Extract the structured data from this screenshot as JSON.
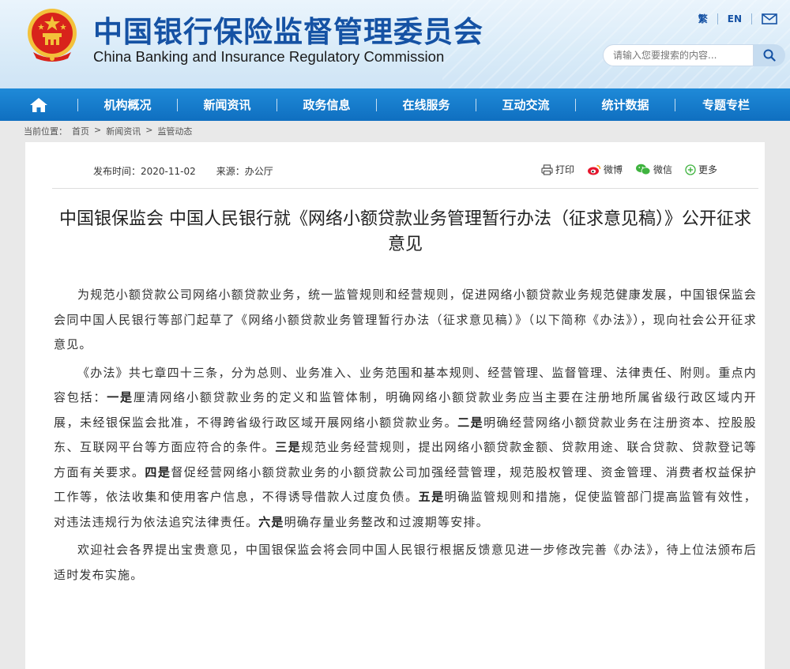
{
  "header": {
    "title_cn": "中国银行保险监督管理委员会",
    "title_en": "China Banking and Insurance Regulatory Commission",
    "lang_traditional": "繁",
    "lang_en": "EN",
    "search_placeholder": "请输入您要搜索的内容...",
    "icons": {
      "emblem": "national-emblem",
      "mail": "mail-icon",
      "search": "search-icon"
    }
  },
  "nav": {
    "home_icon": "home-icon",
    "items": [
      "机构概况",
      "新闻资讯",
      "政务信息",
      "在线服务",
      "互动交流",
      "统计数据",
      "专题专栏"
    ]
  },
  "breadcrumb": {
    "prefix": "当前位置：",
    "items": [
      "首页",
      "新闻资讯",
      "监管动态"
    ],
    "separator": ">"
  },
  "article": {
    "publish_time": "发布时间：2020-11-02",
    "source": "来源：办公厅",
    "share": {
      "print": "打印",
      "weibo": "微博",
      "wechat": "微信",
      "more": "更多"
    },
    "title": "中国银保监会 中国人民银行就《网络小额贷款业务管理暂行办法（征求意见稿）》公开征求意见",
    "p1": "为规范小额贷款公司网络小额贷款业务，统一监管规则和经营规则，促进网络小额贷款业务规范健康发展，中国银保监会会同中国人民银行等部门起草了《网络小额贷款业务管理暂行办法（征求意见稿）》（以下简称《办法》），现向社会公开征求意见。",
    "p2_intro": "《办法》共七章四十三条，分为总则、业务准入、业务范围和基本规则、经营管理、监督管理、法律责任、附则。重点内容包括：",
    "p2_k1": "一是",
    "p2_t1": "厘清网络小额贷款业务的定义和监管体制，明确网络小额贷款业务应当主要在注册地所属省级行政区域内开展，未经银保监会批准，不得跨省级行政区域开展网络小额贷款业务。",
    "p2_k2": "二是",
    "p2_t2": "明确经营网络小额贷款业务在注册资本、控股股东、互联网平台等方面应符合的条件。",
    "p2_k3": "三是",
    "p2_t3": "规范业务经营规则，提出网络小额贷款金额、贷款用途、联合贷款、贷款登记等方面有关要求。",
    "p2_k4": "四是",
    "p2_t4": "督促经营网络小额贷款业务的小额贷款公司加强经营管理，规范股权管理、资金管理、消费者权益保护工作等，依法收集和使用客户信息，不得诱导借款人过度负债。",
    "p2_k5": "五是",
    "p2_t5": "明确监管规则和措施，促使监管部门提高监管有效性，对违法违规行为依法追究法律责任。",
    "p2_k6": "六是",
    "p2_t6": "明确存量业务整改和过渡期等安排。",
    "p3": "欢迎社会各界提出宝贵意见，中国银保监会将会同中国人民银行根据反馈意见进一步修改完善《办法》，待上位法颁布后适时发布实施。"
  },
  "colors": {
    "brand_blue": "#1552a4",
    "nav_blue": "#0f6fc0",
    "emblem_red": "#d8231b",
    "emblem_gold": "#f3c13a"
  }
}
